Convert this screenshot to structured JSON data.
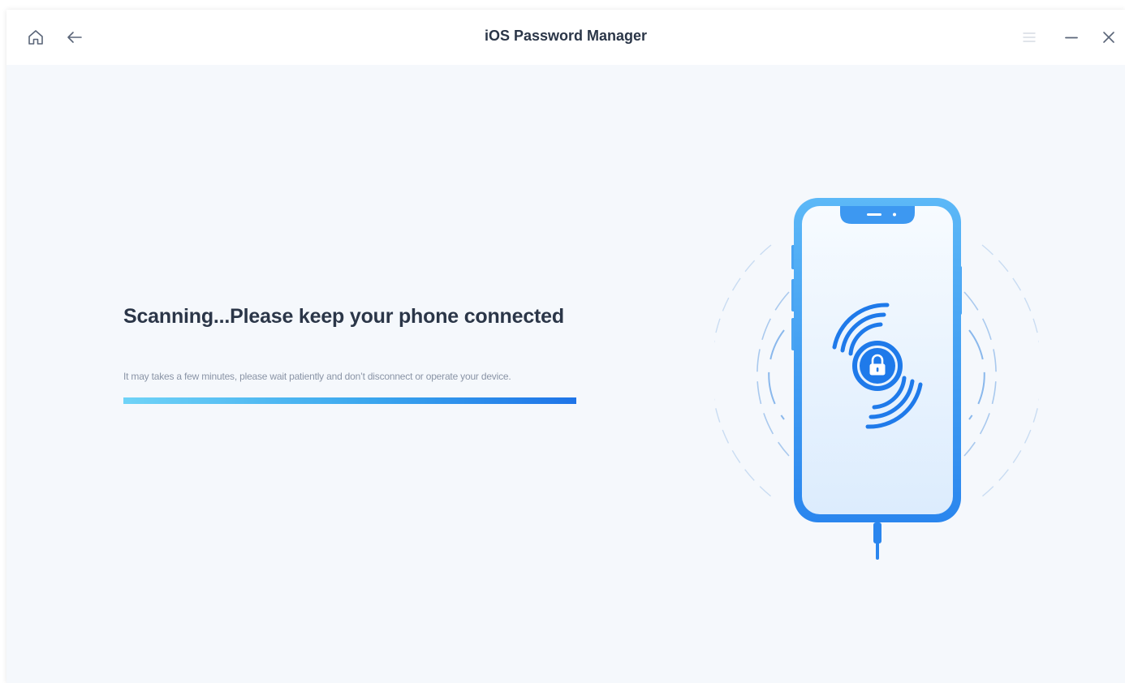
{
  "window": {
    "title": "iOS Password Manager"
  },
  "titlebar": {
    "icons": [
      "home-icon",
      "back-arrow-icon",
      "menu-icon",
      "minimize-icon",
      "close-icon"
    ]
  },
  "main": {
    "headline": "Scanning...Please keep your phone connected",
    "subtext": "It may takes a few minutes, please wait patiently and don’t disconnect or operate your device.",
    "progress_percent": 100
  },
  "colors": {
    "accent": "#1e74e8",
    "accent_light": "#6fd3f7",
    "title_text": "#2b3648",
    "sub_text": "#8a94a6",
    "background": "#f5f8fc"
  }
}
